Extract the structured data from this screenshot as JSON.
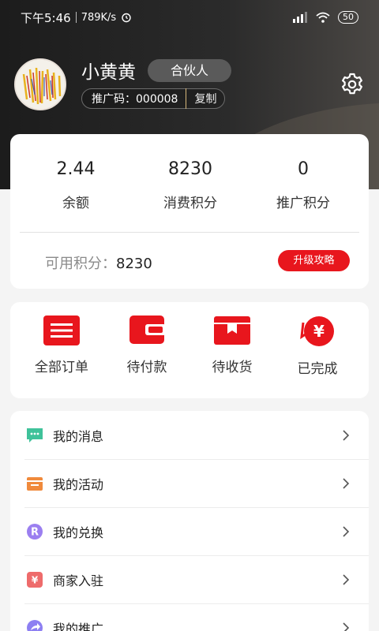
{
  "status_bar": {
    "time": "下午5:46",
    "speed": "789K/s",
    "battery": "50"
  },
  "profile": {
    "username": "小黄黄",
    "role": "合伙人",
    "invite_label": "推广码：000008",
    "copy_label": "复制"
  },
  "stats": [
    {
      "value": "2.44",
      "label": "余额"
    },
    {
      "value": "8230",
      "label": "消费积分"
    },
    {
      "value": "0",
      "label": "推广积分"
    }
  ],
  "points": {
    "label": "可用积分：",
    "value": "8230",
    "upgrade_label": "升级攻略"
  },
  "orders": [
    {
      "label": "全部订单",
      "icon": "list-icon"
    },
    {
      "label": "待付款",
      "icon": "wallet-icon"
    },
    {
      "label": "待收货",
      "icon": "box-icon"
    },
    {
      "label": "已完成",
      "icon": "yuan-coin-icon"
    }
  ],
  "menu": [
    {
      "label": "我的消息",
      "icon": "message-icon",
      "color": "#3fc29a"
    },
    {
      "label": "我的活动",
      "icon": "store-icon",
      "color": "#f08a3c"
    },
    {
      "label": "我的兑换",
      "icon": "redeem-icon",
      "color": "#9b7ff0"
    },
    {
      "label": "商家入驻",
      "icon": "merchant-icon",
      "color": "#ee6b6b"
    },
    {
      "label": "我的推广",
      "icon": "share-icon",
      "color": "#8d7ff2"
    }
  ],
  "colors": {
    "accent": "#e8161d",
    "header": "#222222"
  }
}
